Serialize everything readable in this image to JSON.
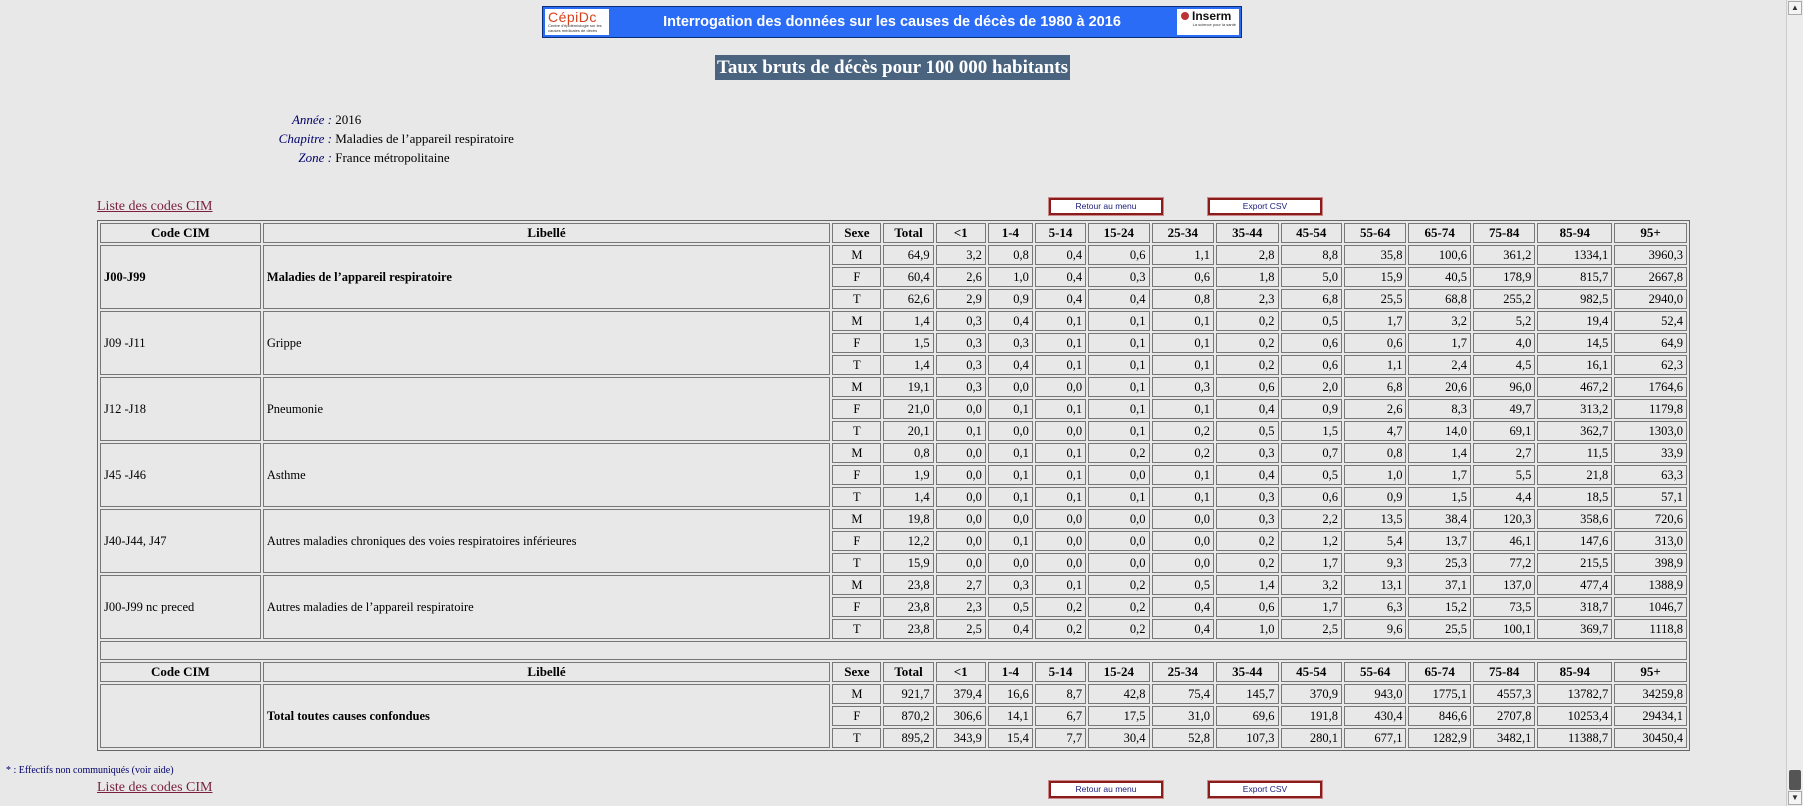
{
  "banner": {
    "left_logo_text": "CépiDc",
    "left_logo_sub": "Centre d'épidémiologie sur les causes médicales de décès",
    "title": "Interrogation des données sur les causes de décès de 1980 à 2016",
    "right_logo_text": "Inserm",
    "right_logo_sub": "La science pour la santé"
  },
  "page_title": "Taux bruts de décès pour 100 000 habitants",
  "meta": [
    {
      "key": "Année :",
      "value": "2016"
    },
    {
      "key": "Chapitre :",
      "value": "Maladies de l’appareil respiratoire"
    },
    {
      "key": "Zone :",
      "value": "France métropolitaine"
    }
  ],
  "links": {
    "codes_cim": "Liste des codes CIM"
  },
  "buttons": {
    "retour": "Retour au menu",
    "export": "Export CSV"
  },
  "columns": [
    "Code CIM",
    "Libellé",
    "Sexe",
    "Total",
    "<1",
    "1-4",
    "5-14",
    "15-24",
    "25-34",
    "35-44",
    "45-54",
    "55-64",
    "65-74",
    "75-84",
    "85-94",
    "95+"
  ],
  "groups": [
    {
      "code": "J00-J99",
      "label": "Maladies de l’appareil respiratoire",
      "bold": true,
      "rows": [
        {
          "sex": "M",
          "values": [
            "64,9",
            "3,2",
            "0,8",
            "0,4",
            "0,6",
            "1,1",
            "2,8",
            "8,8",
            "35,8",
            "100,6",
            "361,2",
            "1334,1",
            "3960,3"
          ]
        },
        {
          "sex": "F",
          "values": [
            "60,4",
            "2,6",
            "1,0",
            "0,4",
            "0,3",
            "0,6",
            "1,8",
            "5,0",
            "15,9",
            "40,5",
            "178,9",
            "815,7",
            "2667,8"
          ]
        },
        {
          "sex": "T",
          "values": [
            "62,6",
            "2,9",
            "0,9",
            "0,4",
            "0,4",
            "0,8",
            "2,3",
            "6,8",
            "25,5",
            "68,8",
            "255,2",
            "982,5",
            "2940,0"
          ]
        }
      ]
    },
    {
      "code": "J09 -J11",
      "label": "Grippe",
      "bold": false,
      "rows": [
        {
          "sex": "M",
          "values": [
            "1,4",
            "0,3",
            "0,4",
            "0,1",
            "0,1",
            "0,1",
            "0,2",
            "0,5",
            "1,7",
            "3,2",
            "5,2",
            "19,4",
            "52,4"
          ]
        },
        {
          "sex": "F",
          "values": [
            "1,5",
            "0,3",
            "0,3",
            "0,1",
            "0,1",
            "0,1",
            "0,2",
            "0,6",
            "0,6",
            "1,7",
            "4,0",
            "14,5",
            "64,9"
          ]
        },
        {
          "sex": "T",
          "values": [
            "1,4",
            "0,3",
            "0,4",
            "0,1",
            "0,1",
            "0,1",
            "0,2",
            "0,6",
            "1,1",
            "2,4",
            "4,5",
            "16,1",
            "62,3"
          ]
        }
      ]
    },
    {
      "code": "J12 -J18",
      "label": "Pneumonie",
      "bold": false,
      "rows": [
        {
          "sex": "M",
          "values": [
            "19,1",
            "0,3",
            "0,0",
            "0,0",
            "0,1",
            "0,3",
            "0,6",
            "2,0",
            "6,8",
            "20,6",
            "96,0",
            "467,2",
            "1764,6"
          ]
        },
        {
          "sex": "F",
          "values": [
            "21,0",
            "0,0",
            "0,1",
            "0,1",
            "0,1",
            "0,1",
            "0,4",
            "0,9",
            "2,6",
            "8,3",
            "49,7",
            "313,2",
            "1179,8"
          ]
        },
        {
          "sex": "T",
          "values": [
            "20,1",
            "0,1",
            "0,0",
            "0,0",
            "0,1",
            "0,2",
            "0,5",
            "1,5",
            "4,7",
            "14,0",
            "69,1",
            "362,7",
            "1303,0"
          ]
        }
      ]
    },
    {
      "code": "J45 -J46",
      "label": "Asthme",
      "bold": false,
      "rows": [
        {
          "sex": "M",
          "values": [
            "0,8",
            "0,0",
            "0,1",
            "0,1",
            "0,2",
            "0,2",
            "0,3",
            "0,7",
            "0,8",
            "1,4",
            "2,7",
            "11,5",
            "33,9"
          ]
        },
        {
          "sex": "F",
          "values": [
            "1,9",
            "0,0",
            "0,1",
            "0,1",
            "0,0",
            "0,1",
            "0,4",
            "0,5",
            "1,0",
            "1,7",
            "5,5",
            "21,8",
            "63,3"
          ]
        },
        {
          "sex": "T",
          "values": [
            "1,4",
            "0,0",
            "0,1",
            "0,1",
            "0,1",
            "0,1",
            "0,3",
            "0,6",
            "0,9",
            "1,5",
            "4,4",
            "18,5",
            "57,1"
          ]
        }
      ]
    },
    {
      "code": "J40-J44, J47",
      "label": "Autres maladies chroniques des voies respiratoires inférieures",
      "bold": false,
      "rows": [
        {
          "sex": "M",
          "values": [
            "19,8",
            "0,0",
            "0,0",
            "0,0",
            "0,0",
            "0,0",
            "0,3",
            "2,2",
            "13,5",
            "38,4",
            "120,3",
            "358,6",
            "720,6"
          ]
        },
        {
          "sex": "F",
          "values": [
            "12,2",
            "0,0",
            "0,1",
            "0,0",
            "0,0",
            "0,0",
            "0,2",
            "1,2",
            "5,4",
            "13,7",
            "46,1",
            "147,6",
            "313,0"
          ]
        },
        {
          "sex": "T",
          "values": [
            "15,9",
            "0,0",
            "0,0",
            "0,0",
            "0,0",
            "0,0",
            "0,2",
            "1,7",
            "9,3",
            "25,3",
            "77,2",
            "215,5",
            "398,9"
          ]
        }
      ]
    },
    {
      "code": "J00-J99 nc preced",
      "label": "Autres maladies de l’appareil respiratoire",
      "bold": false,
      "rows": [
        {
          "sex": "M",
          "values": [
            "23,8",
            "2,7",
            "0,3",
            "0,1",
            "0,2",
            "0,5",
            "1,4",
            "3,2",
            "13,1",
            "37,1",
            "137,0",
            "477,4",
            "1388,9"
          ]
        },
        {
          "sex": "F",
          "values": [
            "23,8",
            "2,3",
            "0,5",
            "0,2",
            "0,2",
            "0,4",
            "0,6",
            "1,7",
            "6,3",
            "15,2",
            "73,5",
            "318,7",
            "1046,7"
          ]
        },
        {
          "sex": "T",
          "values": [
            "23,8",
            "2,5",
            "0,4",
            "0,2",
            "0,2",
            "0,4",
            "1,0",
            "2,5",
            "9,6",
            "25,5",
            "100,1",
            "369,7",
            "1118,8"
          ]
        }
      ]
    }
  ],
  "total_group": {
    "code": "",
    "label": "Total toutes causes confondues",
    "bold": true,
    "rows": [
      {
        "sex": "M",
        "values": [
          "921,7",
          "379,4",
          "16,6",
          "8,7",
          "42,8",
          "75,4",
          "145,7",
          "370,9",
          "943,0",
          "1775,1",
          "4557,3",
          "13782,7",
          "34259,8"
        ]
      },
      {
        "sex": "F",
        "values": [
          "870,2",
          "306,6",
          "14,1",
          "6,7",
          "17,5",
          "31,0",
          "69,6",
          "191,8",
          "430,4",
          "846,6",
          "2707,8",
          "10253,4",
          "29434,1"
        ]
      },
      {
        "sex": "T",
        "values": [
          "895,2",
          "343,9",
          "15,4",
          "7,7",
          "30,4",
          "52,8",
          "107,3",
          "280,1",
          "677,1",
          "1282,9",
          "3482,1",
          "11388,7",
          "30450,4"
        ]
      }
    ]
  },
  "footnote": "* : Effectifs non communiqués (voir aide)"
}
